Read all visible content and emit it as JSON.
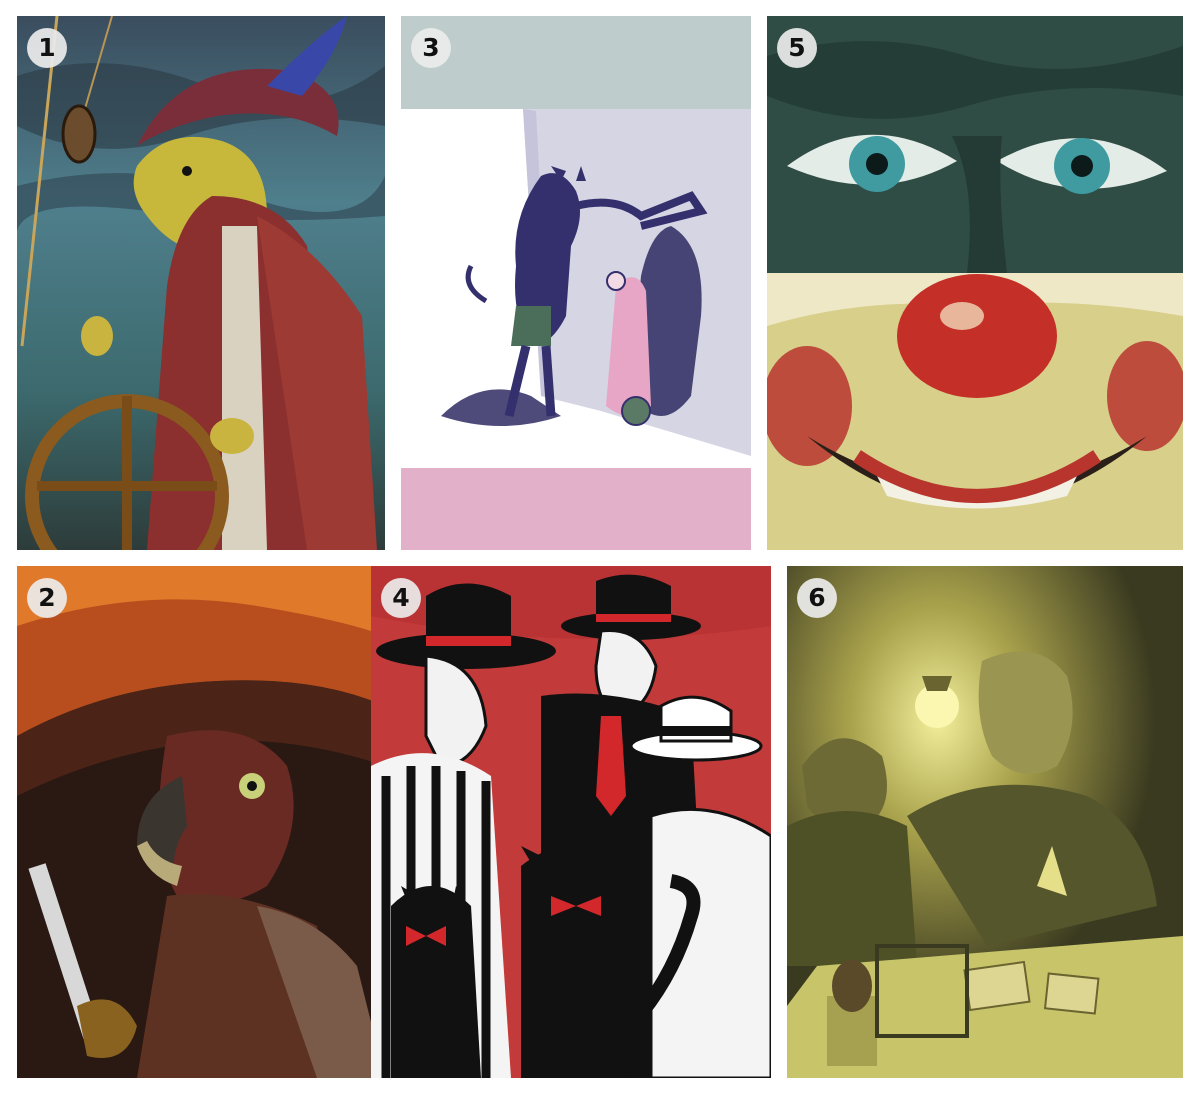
{
  "panels": [
    {
      "number": "1",
      "subject": "eel-sea-captain"
    },
    {
      "number": "3",
      "subject": "wolf-and-red-riding-hood"
    },
    {
      "number": "5",
      "subject": "eyes-and-clown"
    },
    {
      "number": "2",
      "subject": "parrot-pirate"
    },
    {
      "number": "4",
      "subject": "gangsters-and-cats"
    },
    {
      "number": "6",
      "subject": "men-and-mouse-at-table"
    }
  ],
  "colors": {
    "background": "#ffffff",
    "panel3_top_band": "#bfcccc",
    "panel3_wall": "#d6d5e3",
    "panel3_bottom_band": "#e2b0c8",
    "panel4_red": "#c33a3a",
    "panel6_yellow": "#c7c46a"
  }
}
